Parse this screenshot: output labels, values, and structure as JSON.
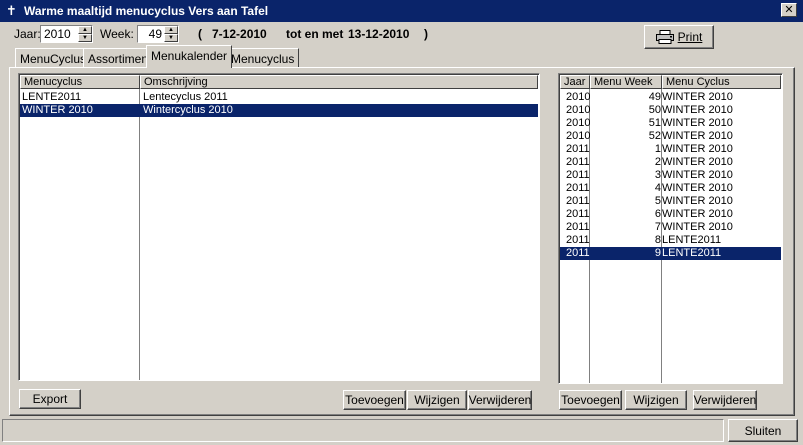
{
  "window": {
    "title": "Warme maaltijd menucyclus Vers aan Tafel",
    "close_glyph": "✕"
  },
  "header": {
    "jaar_label": "Jaar:",
    "jaar_value": "2010",
    "week_label": "Week:",
    "week_value": "49",
    "paren_open": "(",
    "date_from": "7-12-2010",
    "tot_en_met": "tot en met",
    "date_to": "13-12-2010",
    "paren_close": ")",
    "print_label": "Print",
    "print_icon": "printer-icon"
  },
  "tabs": [
    {
      "label": "MenuCyclus"
    },
    {
      "label": "Assortiment"
    },
    {
      "label": "Menukalender"
    },
    {
      "label": "Menucyclus"
    }
  ],
  "active_tab": 2,
  "left_table": {
    "columns": [
      "Menucyclus",
      "Omschrijving"
    ],
    "rows": [
      {
        "menucyclus": "LENTE2011",
        "omschrijving": "Lentecyclus 2011"
      },
      {
        "menucyclus": "WINTER 2010",
        "omschrijving": "Wintercyclus 2010",
        "selected": true
      }
    ]
  },
  "right_table": {
    "columns": [
      "Jaar",
      "Menu Week",
      "Menu Cyclus"
    ],
    "rows": [
      {
        "jaar": "2010",
        "week": "49",
        "cyclus": "WINTER 2010"
      },
      {
        "jaar": "2010",
        "week": "50",
        "cyclus": "WINTER 2010"
      },
      {
        "jaar": "2010",
        "week": "51",
        "cyclus": "WINTER 2010"
      },
      {
        "jaar": "2010",
        "week": "52",
        "cyclus": "WINTER 2010"
      },
      {
        "jaar": "2011",
        "week": "1",
        "cyclus": "WINTER 2010"
      },
      {
        "jaar": "2011",
        "week": "2",
        "cyclus": "WINTER 2010"
      },
      {
        "jaar": "2011",
        "week": "3",
        "cyclus": "WINTER 2010"
      },
      {
        "jaar": "2011",
        "week": "4",
        "cyclus": "WINTER 2010"
      },
      {
        "jaar": "2011",
        "week": "5",
        "cyclus": "WINTER 2010"
      },
      {
        "jaar": "2011",
        "week": "6",
        "cyclus": "WINTER 2010"
      },
      {
        "jaar": "2011",
        "week": "7",
        "cyclus": "WINTER 2010"
      },
      {
        "jaar": "2011",
        "week": "8",
        "cyclus": "LENTE2011"
      },
      {
        "jaar": "2011",
        "week": "9",
        "cyclus": "LENTE2011",
        "selected": true
      }
    ]
  },
  "left_buttons": {
    "export": "Export",
    "toevoegen": "Toevoegen",
    "wijzigen": "Wijzigen",
    "verwijderen": "Verwijderen"
  },
  "right_buttons": {
    "toevoegen": "Toevoegen",
    "wijzigen": "Wijzigen",
    "verwijderen": "Verwijderen"
  },
  "footer": {
    "sluiten": "Sluiten"
  },
  "colors": {
    "titlebar": "#0a246a",
    "selection": "#0a246a",
    "face": "#d4d0c8"
  }
}
